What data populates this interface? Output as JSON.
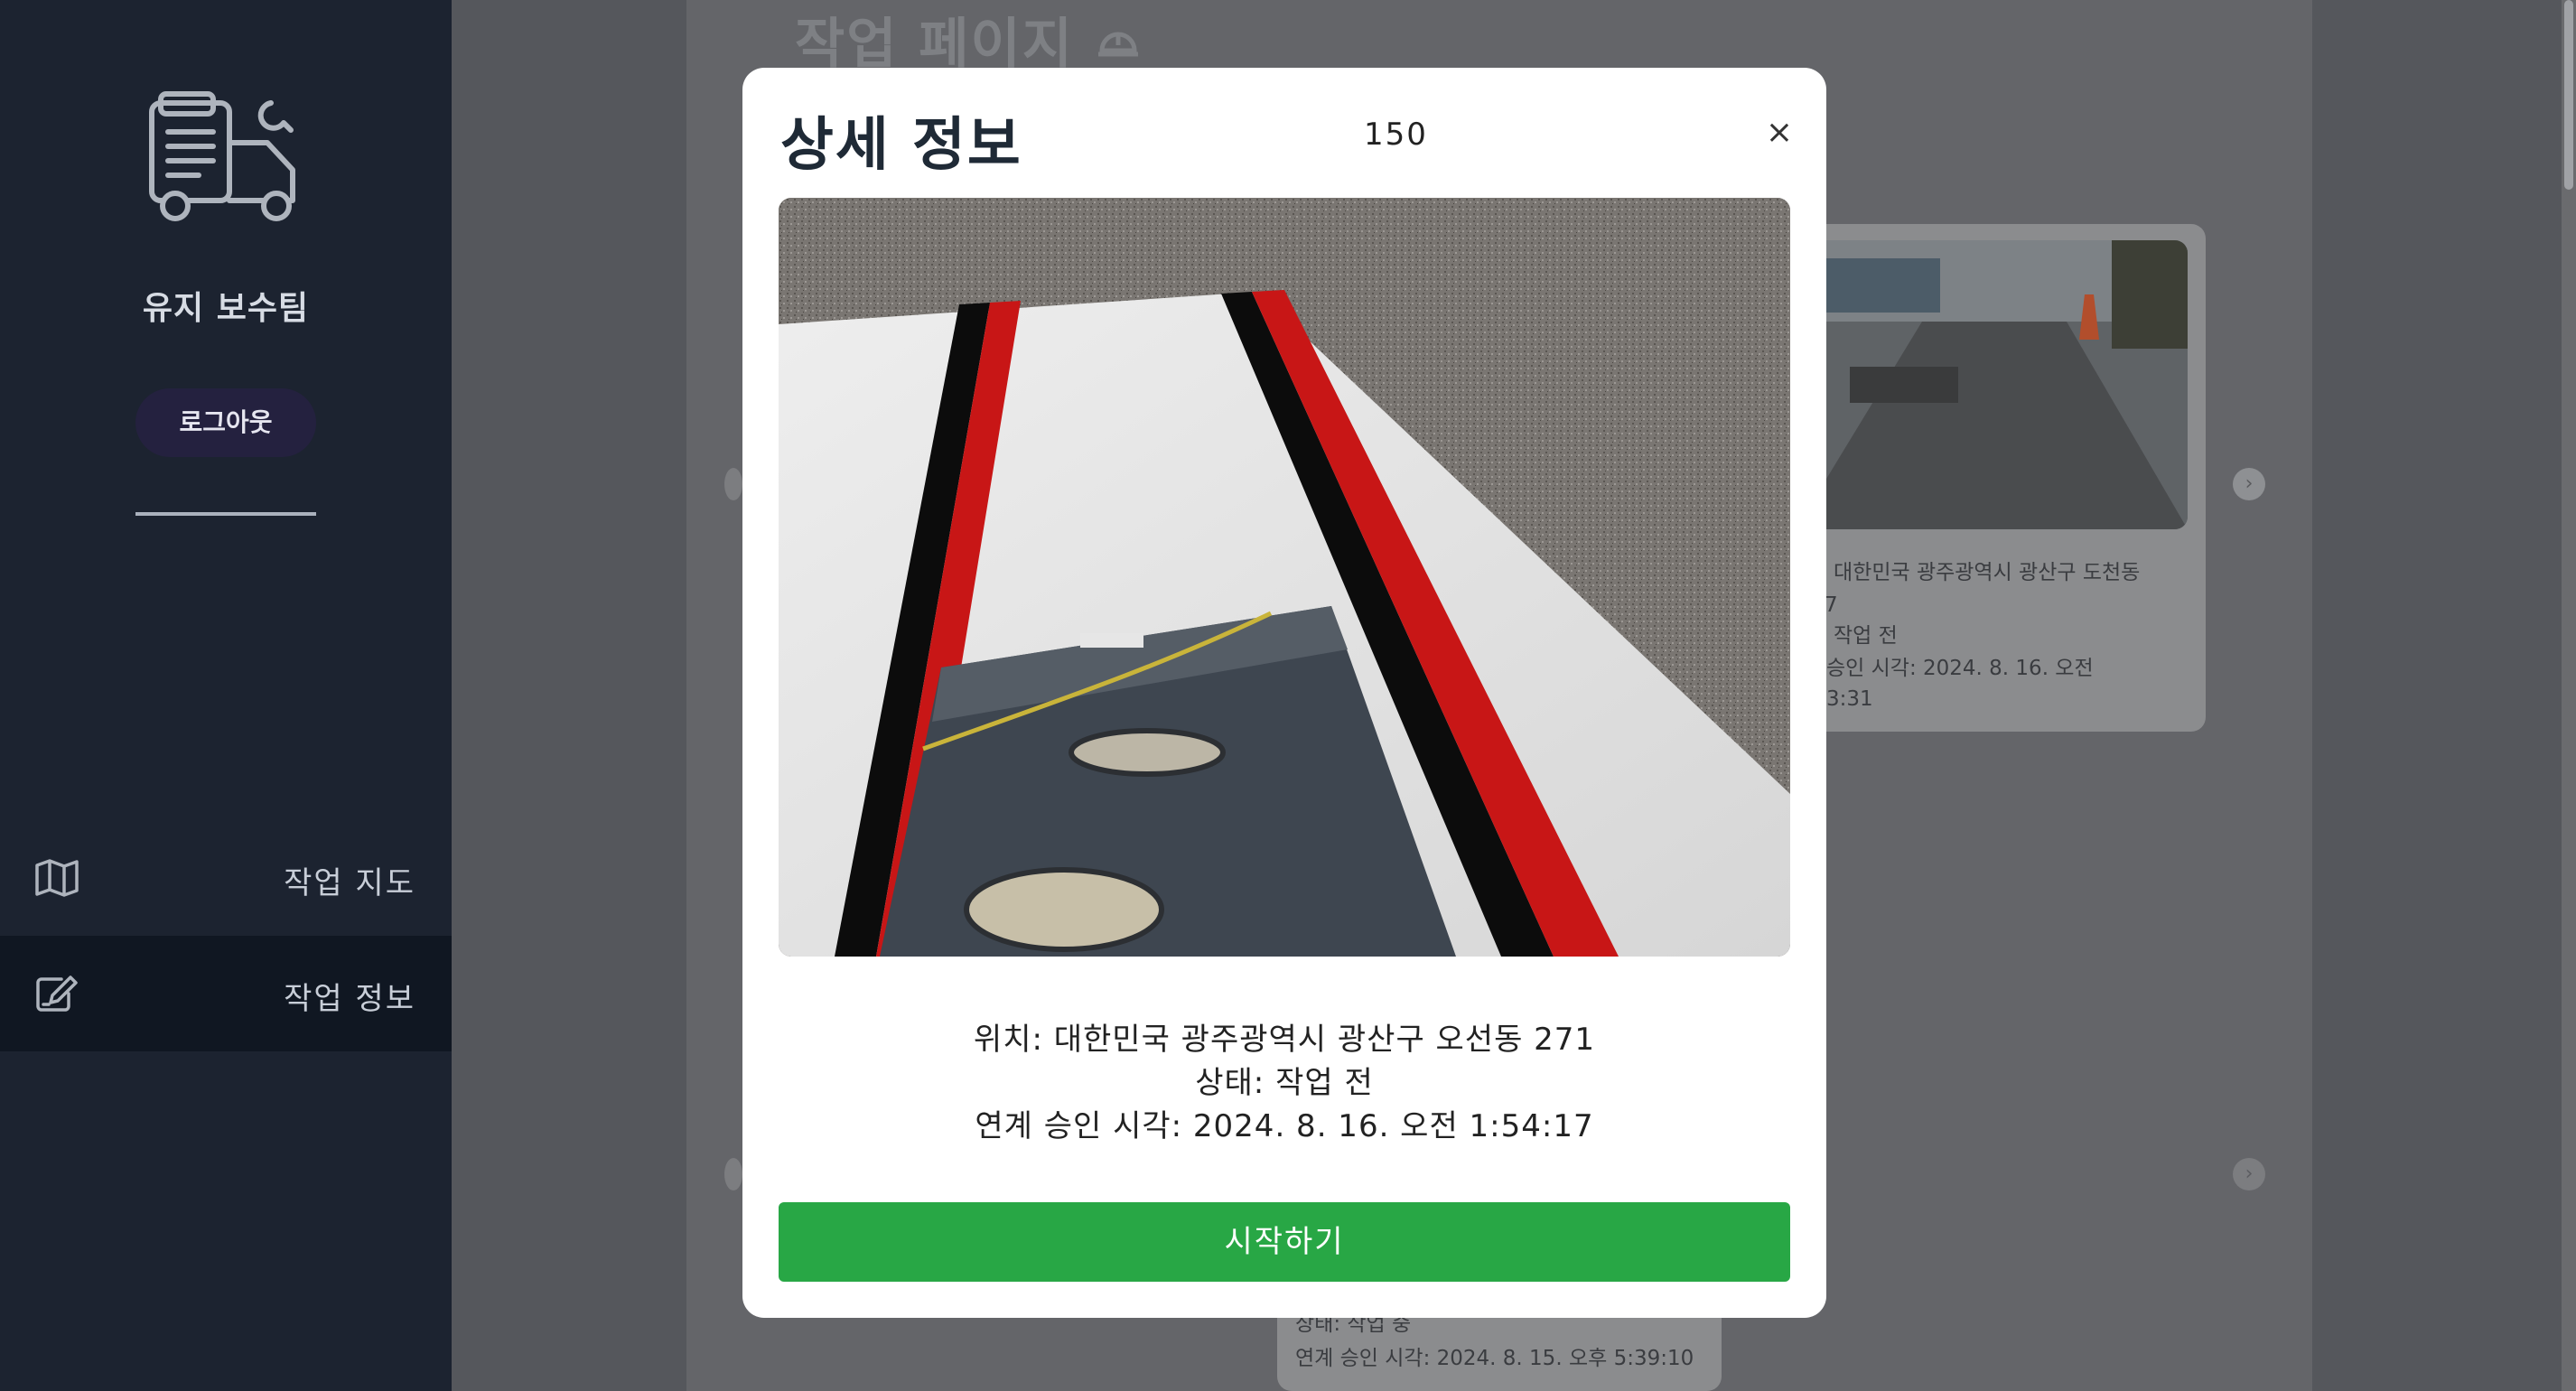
{
  "sidebar": {
    "team_name": "유지 보수팀",
    "logout_label": "로그아웃",
    "nav": [
      {
        "label": "작업 지도",
        "icon": "map-icon",
        "active": false
      },
      {
        "label": "작업 정보",
        "icon": "edit-icon",
        "active": true
      }
    ]
  },
  "page": {
    "title": "작업 페이지",
    "cards": [
      {
        "location_partial": "대한민국 광주광역시 광산구 도천동",
        "line2_partial": "7",
        "status_partial": "작업 전",
        "approval_partial": "승인 시각: 2024. 8. 16. 오전",
        "time_partial": "3:31"
      },
      {
        "status": "상태: 작업 중",
        "approval": "연계 승인 시각: 2024. 8. 15. 오후 5:39:10"
      }
    ]
  },
  "modal": {
    "title": "상세 정보",
    "id": "150",
    "close_label": "×",
    "location": "위치: 대한민국 광주광역시 광산구 오선동 271",
    "status": "상태: 작업 전",
    "approval_time": "연계 승인 시각: 2024. 8. 16. 오전 1:54:17",
    "start_label": "시작하기"
  },
  "colors": {
    "sidebar_bg": "#1c2330",
    "active_nav_bg": "#101722",
    "start_button": "#28a745",
    "overlay": "#55575c"
  }
}
